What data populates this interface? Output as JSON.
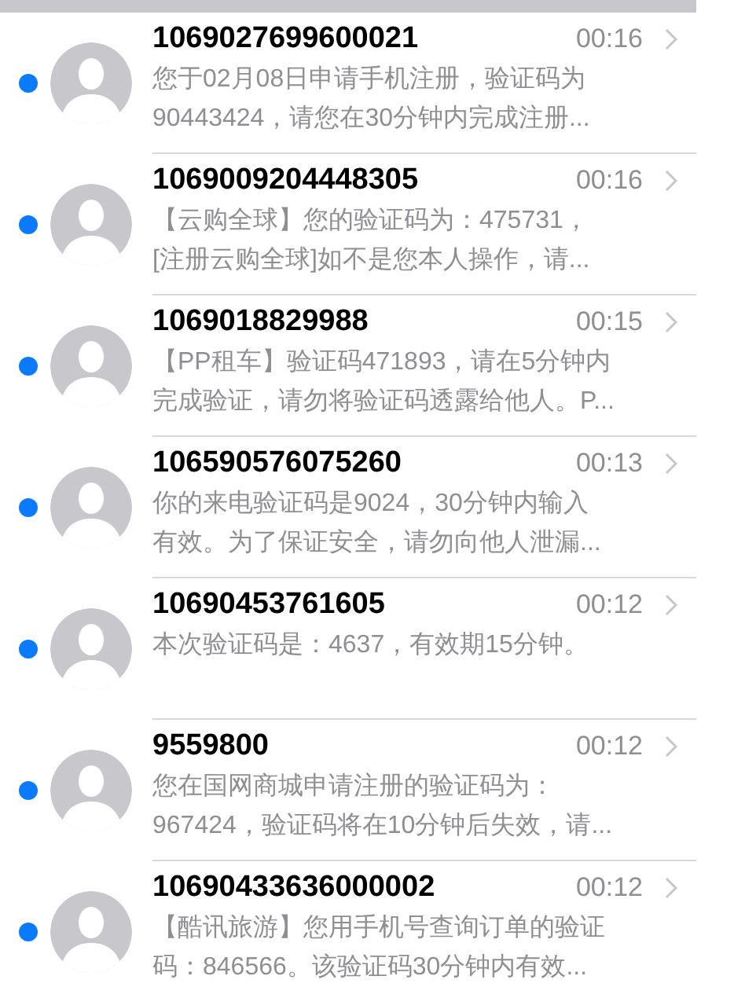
{
  "messages": [
    {
      "sender": "1069027699600021",
      "time": "00:16",
      "unread": true,
      "preview": [
        "您于02月08日申请手机注册，验证码为",
        "90443424，请您在30分钟内完成注册..."
      ]
    },
    {
      "sender": "1069009204448305",
      "time": "00:16",
      "unread": true,
      "preview": [
        "【云购全球】您的验证码为：475731，",
        "[注册云购全球]如不是您本人操作，请..."
      ]
    },
    {
      "sender": "1069018829988",
      "time": "00:15",
      "unread": true,
      "preview": [
        "【PP租车】验证码471893，请在5分钟内",
        "完成验证，请勿将验证码透露给他人。P..."
      ]
    },
    {
      "sender": "106590576075260",
      "time": "00:13",
      "unread": true,
      "preview": [
        "你的来电验证码是9024，30分钟内输入",
        "有效。为了保证安全，请勿向他人泄漏..."
      ]
    },
    {
      "sender": "10690453761605",
      "time": "00:12",
      "unread": true,
      "preview": [
        "本次验证码是：4637，有效期15分钟。"
      ]
    },
    {
      "sender": "9559800",
      "time": "00:12",
      "unread": true,
      "preview": [
        "您在国网商城申请注册的验证码为：",
        "967424，验证码将在10分钟后失效，请..."
      ]
    },
    {
      "sender": "10690433636000002",
      "time": "00:12",
      "unread": true,
      "preview": [
        "【酷讯旅游】您用手机号查询订单的验证",
        "码：846566。该验证码30分钟内有效..."
      ]
    }
  ]
}
